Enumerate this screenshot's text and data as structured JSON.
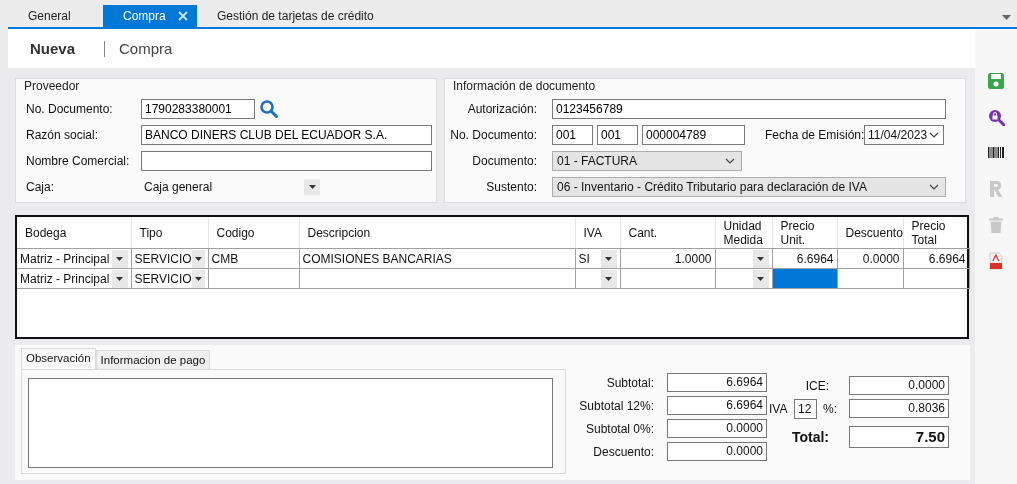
{
  "tabs": [
    {
      "label": "General",
      "selected": false,
      "closable": false
    },
    {
      "label": "Compra",
      "selected": true,
      "closable": true
    },
    {
      "label": "Gestión de tarjetas de crédito",
      "selected": false,
      "closable": false
    }
  ],
  "header": {
    "title": "Nueva",
    "subtitle": "Compra"
  },
  "proveedor": {
    "legend": "Proveedor",
    "fields": [
      {
        "kind": "search",
        "label": "No. Documento:",
        "value": "1790283380001"
      },
      {
        "kind": "text",
        "label": "Razón social:",
        "value": "BANCO DINERS CLUB DEL ECUADOR S.A."
      },
      {
        "kind": "text",
        "label": "Nombre Comercial:"
      },
      {
        "kind": "combo",
        "label": "Caja:",
        "value": "Caja general"
      }
    ]
  },
  "documento": {
    "legend": "Información de documento",
    "autorizacion": {
      "label": "Autorización:",
      "value": "0123456789"
    },
    "numero": {
      "label": "No. Documento:",
      "parts": [
        "001",
        "001",
        "000004789"
      ]
    },
    "fecha": {
      "label": "Fecha de Emisión:",
      "value": "11/04/2023"
    },
    "tipo": {
      "label": "Documento:",
      "value": "01 - FACTURA"
    },
    "sustento": {
      "label": "Sustento:",
      "value": "06 - Inventario - Crédito Tributario para declaración de IVA"
    }
  },
  "table": {
    "columns": [
      "Bodega",
      "Tipo",
      "Codigo",
      "Descripcion",
      "IVA",
      "Cant.",
      "Unidad\nMedida",
      "Precio\nUnit.",
      "Descuento",
      "Precio\nTotal"
    ],
    "rows": [
      {
        "cells": [
          {
            "kind": "combo",
            "value": "Matriz - Principal",
            "selected": false
          },
          {
            "kind": "combo",
            "value": "SERVICIO",
            "selected": false
          },
          {
            "kind": "text",
            "value": "CMB",
            "selected": false
          },
          {
            "kind": "text",
            "value": "COMISIONES BANCARIAS",
            "selected": false
          },
          {
            "kind": "combo",
            "value": "SI",
            "selected": false
          },
          {
            "kind": "number",
            "value": "1.0000",
            "selected": false
          },
          {
            "kind": "combo",
            "selected": false
          },
          {
            "kind": "number",
            "value": "6.6964",
            "selected": false
          },
          {
            "kind": "number",
            "value": "0.0000",
            "selected": false
          },
          {
            "kind": "number",
            "value": "6.6964",
            "selected": false
          }
        ]
      },
      {
        "cells": [
          {
            "kind": "combo",
            "value": "Matriz - Principal",
            "selected": false
          },
          {
            "kind": "combo",
            "value": "SERVICIO",
            "selected": false
          },
          {
            "kind": "text",
            "selected": false
          },
          {
            "kind": "text",
            "selected": false
          },
          {
            "kind": "combo",
            "selected": false
          },
          {
            "kind": "number",
            "selected": false
          },
          {
            "kind": "combo",
            "selected": false
          },
          {
            "kind": "number",
            "selected": true
          },
          {
            "kind": "number",
            "selected": false
          },
          {
            "kind": "number",
            "selected": false
          }
        ]
      }
    ]
  },
  "bottom_tabs": [
    {
      "label": "Observación",
      "selected": true
    },
    {
      "label": "Informacion de pago",
      "selected": false
    }
  ],
  "totals": {
    "left": [
      {
        "label": "Subtotal:",
        "value": "6.6964"
      },
      {
        "label": "Subtotal 12%:",
        "value": "6.6964"
      },
      {
        "label": "Subtotal 0%:",
        "value": "0.0000"
      },
      {
        "label": "Descuento:",
        "value": "0.0000"
      }
    ],
    "ice": {
      "label": "ICE:",
      "value": "0.0000"
    },
    "iva": {
      "label": "IVA",
      "rate": "12",
      "unit": "%:",
      "value": "0.8036"
    },
    "total": {
      "label": "Total:",
      "value": "7.50"
    }
  },
  "toolbar": [
    {
      "kind": "save",
      "disabled": false
    },
    {
      "kind": "lock-search",
      "disabled": false
    },
    {
      "kind": "barcode",
      "disabled": false
    },
    {
      "kind": "letter-r",
      "disabled": true
    },
    {
      "kind": "trash",
      "disabled": true
    },
    {
      "kind": "pdf",
      "disabled": false
    }
  ]
}
